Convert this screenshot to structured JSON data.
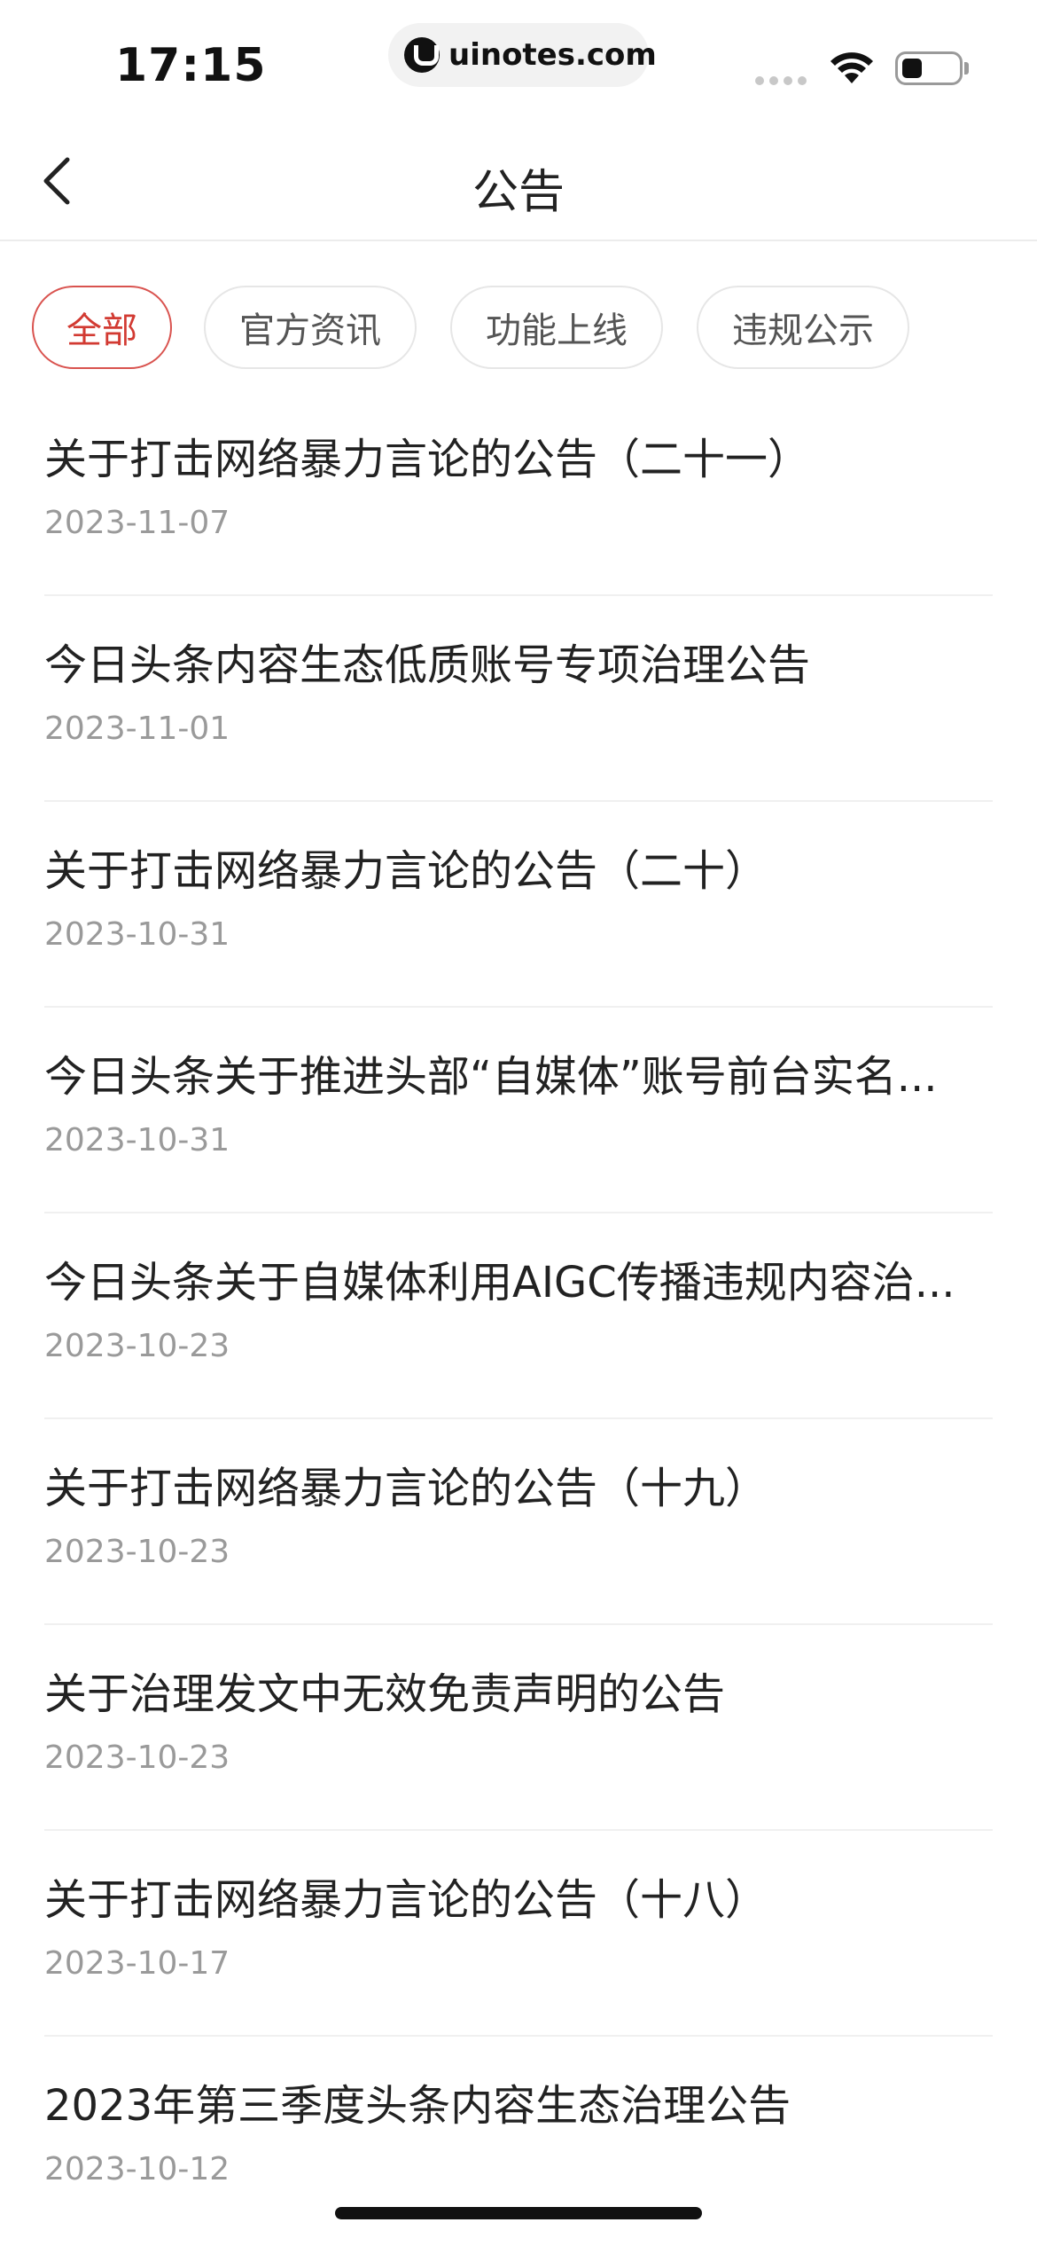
{
  "status_bar": {
    "time": "17:15",
    "url": "uinotes.com"
  },
  "nav": {
    "title": "公告"
  },
  "tabs": [
    {
      "label": "全部",
      "active": true
    },
    {
      "label": "官方资讯",
      "active": false
    },
    {
      "label": "功能上线",
      "active": false
    },
    {
      "label": "违规公示",
      "active": false
    }
  ],
  "announcements": [
    {
      "title": "关于打击网络暴力言论的公告（二十一）",
      "date": "2023-11-07"
    },
    {
      "title": "今日头条内容生态低质账号专项治理公告",
      "date": "2023-11-01"
    },
    {
      "title": "关于打击网络暴力言论的公告（二十）",
      "date": "2023-10-31"
    },
    {
      "title": "今日头条关于推进头部“自媒体”账号前台实名...",
      "date": "2023-10-31"
    },
    {
      "title": "今日头条关于自媒体利用AIGC传播违规内容治...",
      "date": "2023-10-23"
    },
    {
      "title": "关于打击网络暴力言论的公告（十九）",
      "date": "2023-10-23"
    },
    {
      "title": "关于治理发文中无效免责声明的公告",
      "date": "2023-10-23"
    },
    {
      "title": "关于打击网络暴力言论的公告（十八）",
      "date": "2023-10-17"
    },
    {
      "title": "2023年第三季度头条内容生态治理公告",
      "date": "2023-10-12"
    }
  ],
  "colors": {
    "accent": "#d23a32",
    "date_text": "#9a9a9a",
    "divider": "#f0f0f0"
  }
}
